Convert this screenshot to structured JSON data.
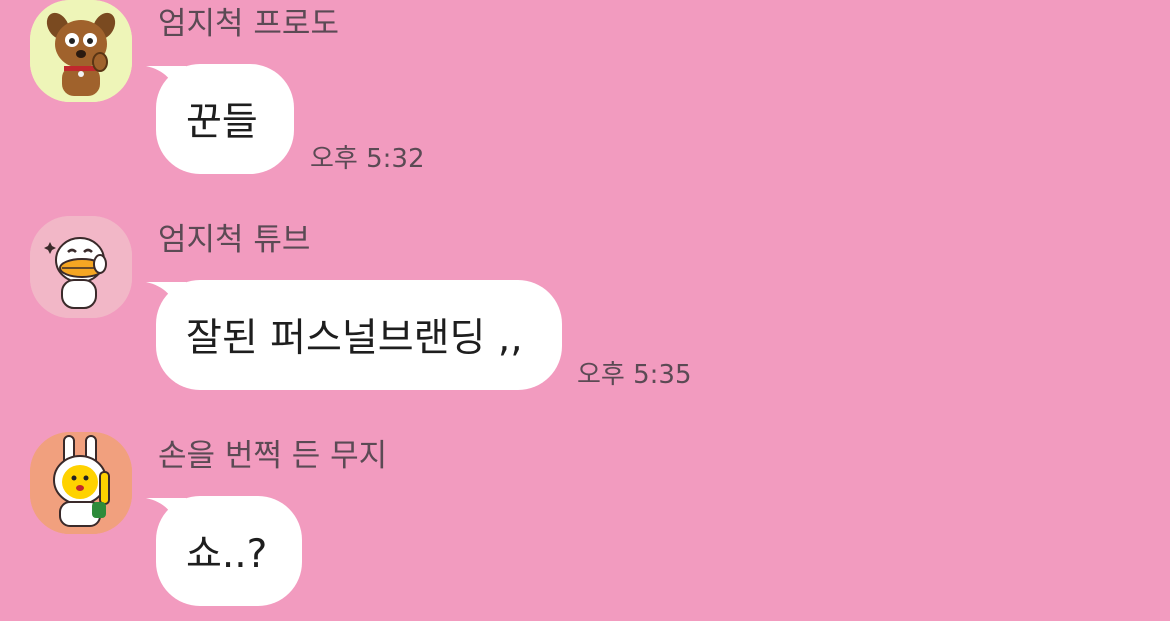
{
  "messages": [
    {
      "sender": "엄지척 프로도",
      "text": "꾼들",
      "time": "오후 5:32",
      "avatar_icon": "frodo-dog-icon",
      "avatar_bg": "#eef5b8"
    },
    {
      "sender": "엄지척 튜브",
      "text": "잘된 퍼스널브랜딩 ,,",
      "time": "오후 5:35",
      "avatar_icon": "tube-duck-icon",
      "avatar_bg": "#f2b7c7"
    },
    {
      "sender": "손을 번쩍 든 무지",
      "text": "쇼..?",
      "time": "",
      "avatar_icon": "muzi-rabbit-icon",
      "avatar_bg": "#f1a07e"
    }
  ],
  "colors": {
    "background": "#f29bbf",
    "bubble": "#ffffff",
    "meta_text": "#5b4a54"
  }
}
